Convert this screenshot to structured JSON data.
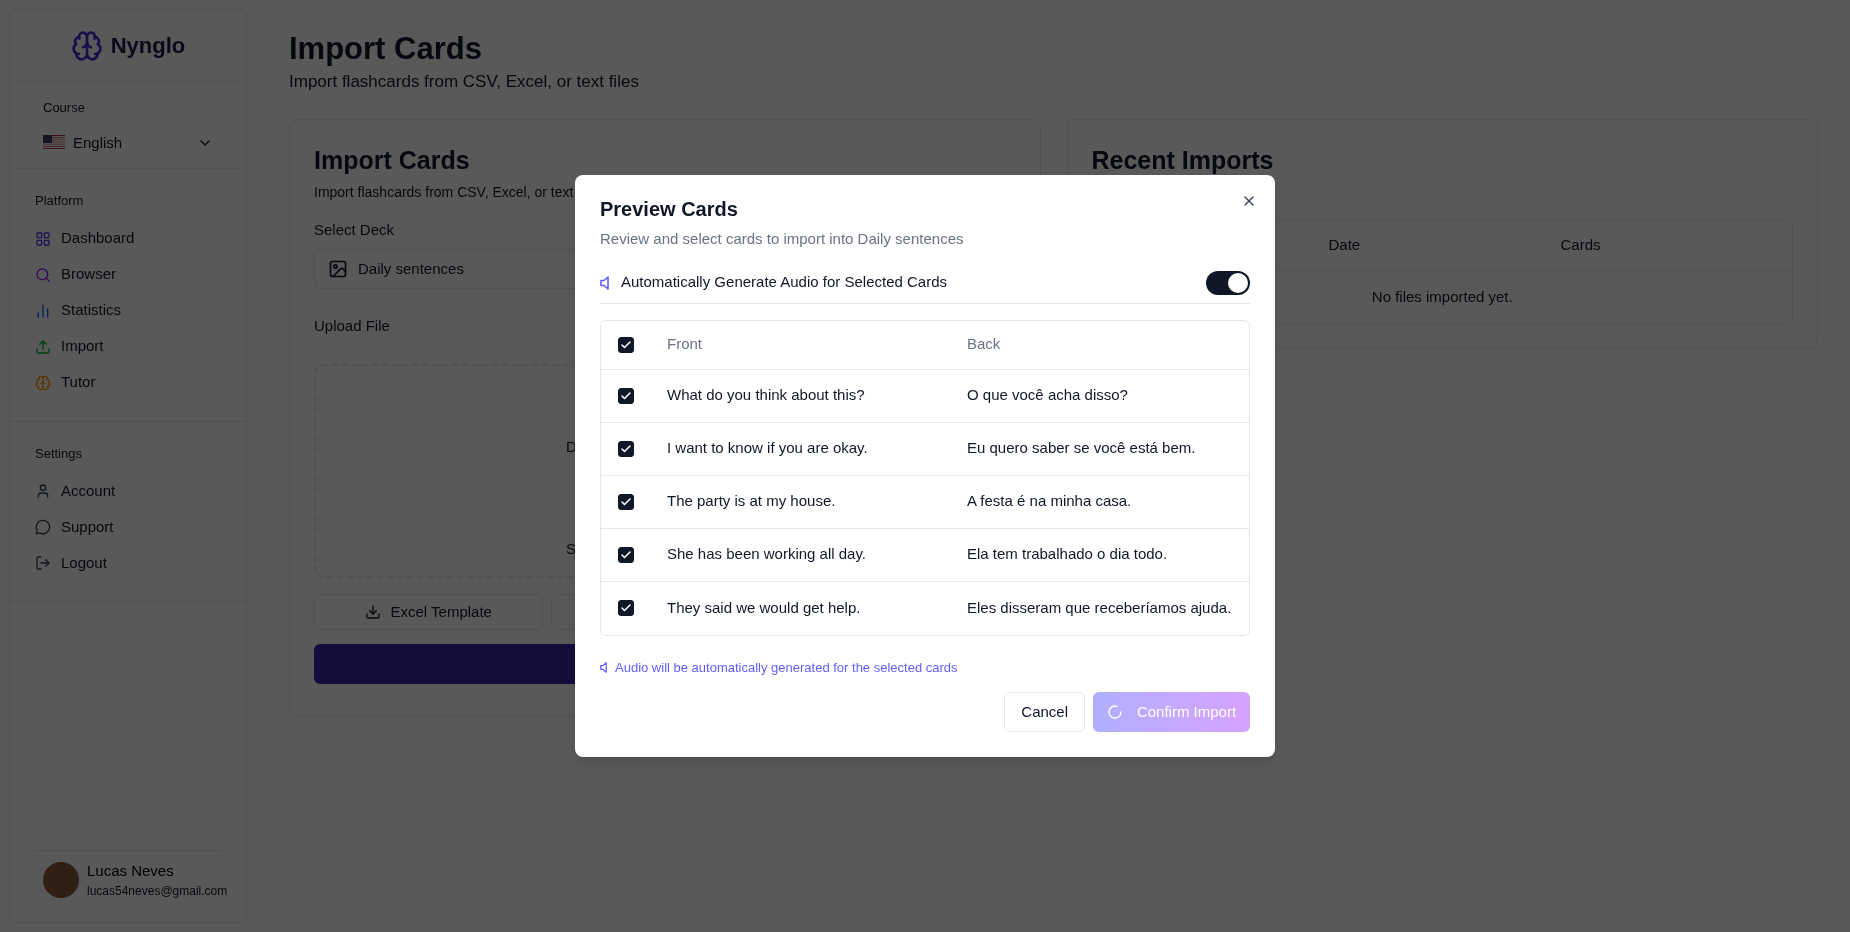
{
  "sidebar": {
    "brand": "Nynglo",
    "course_label": "Course",
    "course": "English",
    "sections": [
      {
        "title": "Platform",
        "items": [
          {
            "label": "Dashboard"
          },
          {
            "label": "Browser"
          },
          {
            "label": "Statistics"
          },
          {
            "label": "Import"
          },
          {
            "label": "Tutor"
          }
        ]
      },
      {
        "title": "Settings",
        "items": [
          {
            "label": "Account"
          },
          {
            "label": "Support"
          },
          {
            "label": "Logout"
          }
        ]
      }
    ],
    "user": {
      "name": "Lucas Neves",
      "email": "lucas54neves@gmail.com"
    }
  },
  "page": {
    "title": "Import Cards",
    "subtitle": "Import flashcards from CSV, Excel, or text files"
  },
  "import_card": {
    "title": "Import Cards",
    "subtitle": "Import flashcards from CSV, Excel, or text",
    "deck_label": "Select Deck",
    "deck_value": "Daily sentences",
    "upload_label": "Upload File",
    "dropzone_texts": [
      "D",
      "S"
    ],
    "template_buttons": [
      "Excel Template"
    ]
  },
  "recent_imports": {
    "title": "Recent Imports",
    "columns": [
      "Date",
      "Cards"
    ],
    "empty": "No files imported yet."
  },
  "dialog": {
    "title": "Preview Cards",
    "description": "Review and select cards to import into Daily sentences",
    "audio_toggle": {
      "label": "Automatically Generate Audio for Selected Cards",
      "on": true
    },
    "table": {
      "columns": [
        "Front",
        "Back"
      ],
      "all_checked": true,
      "rows": [
        {
          "front": "What do you think about this?",
          "back": "O que você acha disso?",
          "checked": true
        },
        {
          "front": "I want to know if you are okay.",
          "back": "Eu quero saber se você está bem.",
          "checked": true
        },
        {
          "front": "The party is at my house.",
          "back": "A festa é na minha casa.",
          "checked": true
        },
        {
          "front": "She has been working all day.",
          "back": "Ela tem trabalhado o dia todo.",
          "checked": true
        },
        {
          "front": "They said we would get help.",
          "back": "Eles disseram que receberíamos ajuda.",
          "checked": true
        }
      ]
    },
    "note": "Audio will be automatically generated for the selected cards",
    "cancel": "Cancel",
    "confirm": {
      "label": "Confirm Import",
      "loading": true,
      "disabled": true
    }
  }
}
